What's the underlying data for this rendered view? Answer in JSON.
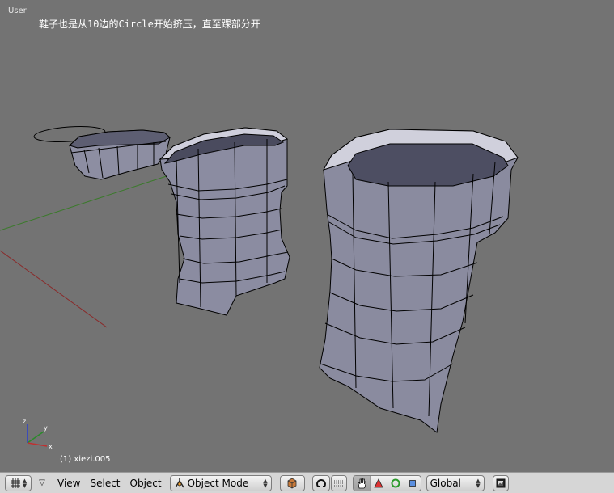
{
  "viewport": {
    "view_name": "User",
    "annotation": "鞋子也是从10边的Circle开始挤压，直至踝部分开",
    "object_info": "(1) xiezi.005",
    "axes": {
      "x": "x",
      "y": "y",
      "z": "z"
    },
    "colors": {
      "background": "#737373",
      "mesh_face": "#8e8fa3",
      "mesh_edge": "#000000",
      "x_axis": "#8a2a2a",
      "y_axis": "#3a7a2a"
    }
  },
  "header": {
    "editor_type_icon": "grid-icon",
    "menus": [
      "View",
      "Select",
      "Object"
    ],
    "mode": "Object Mode",
    "mode_icon": "object-mode-icon",
    "shading_icon": "solid-shading-icon",
    "pivot_icon": "pivot-icon",
    "manipulators": [
      "hand-icon",
      "translate-icon",
      "rotate-icon",
      "scale-icon"
    ],
    "orientation": "Global",
    "render_icon": "render-icon"
  }
}
